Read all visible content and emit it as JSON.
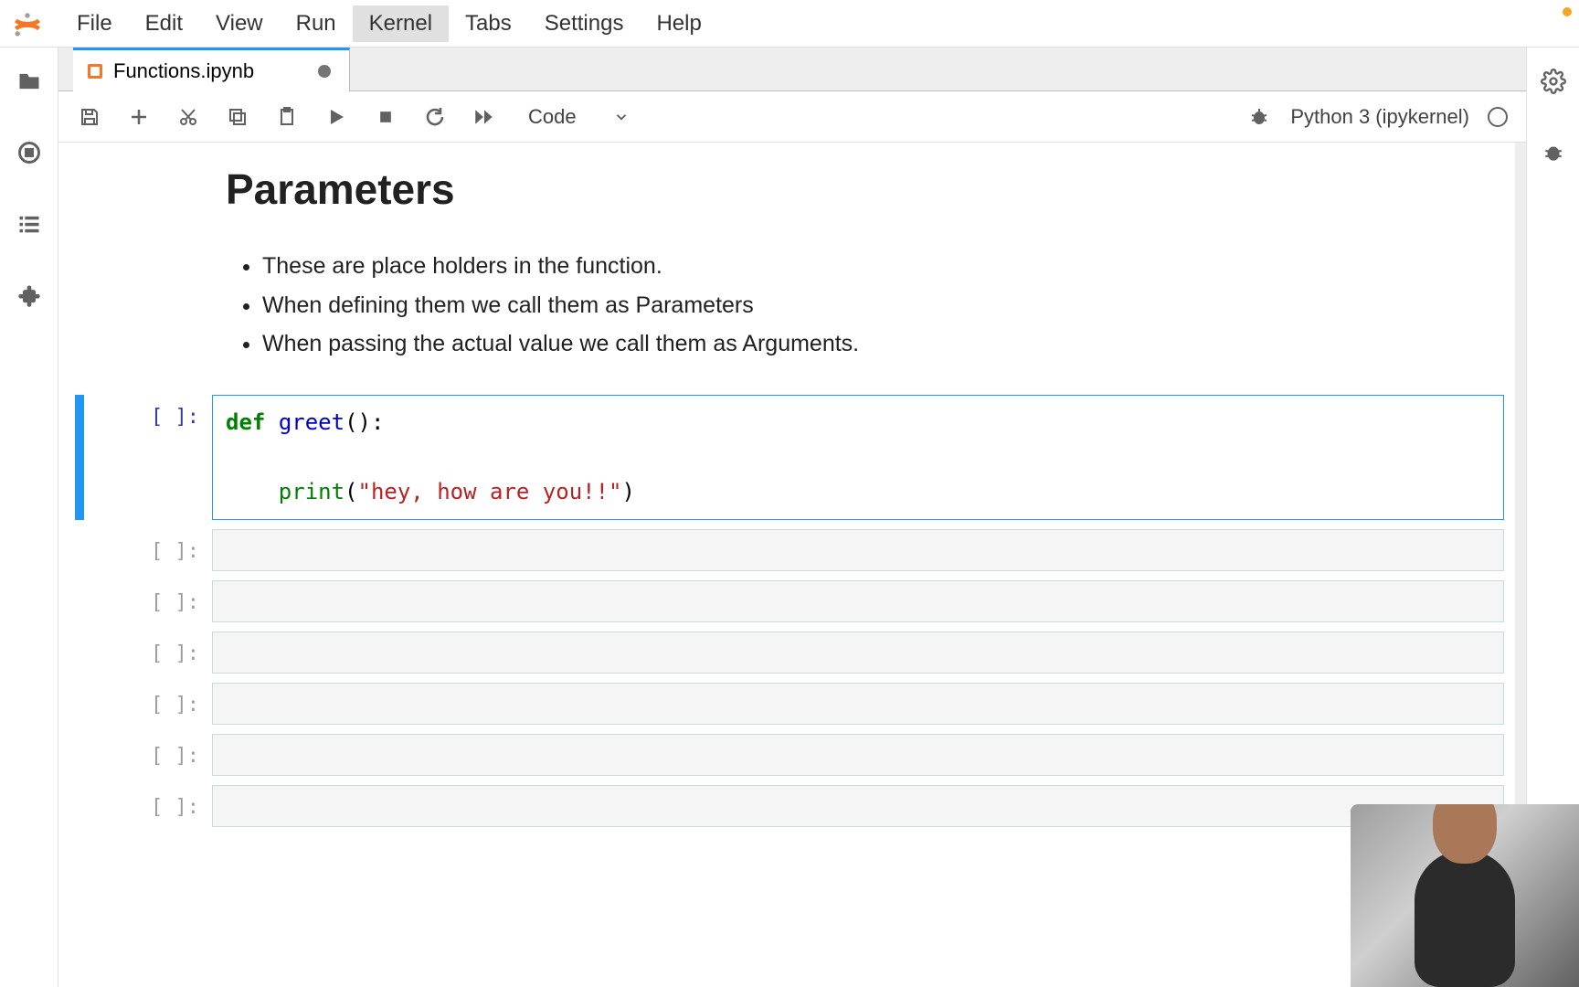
{
  "menu": {
    "items": [
      "File",
      "Edit",
      "View",
      "Run",
      "Kernel",
      "Tabs",
      "Settings",
      "Help"
    ],
    "active_index": 4
  },
  "tab": {
    "label": "Functions.ipynb"
  },
  "toolbar": {
    "cell_type": "Code",
    "kernel_name": "Python 3 (ipykernel)"
  },
  "markdown": {
    "heading": "Parameters",
    "bullets": [
      "These are place holders in the function.",
      "When defining them we call them as Parameters",
      "When passing the actual value we call them as Arguments."
    ]
  },
  "cells": {
    "prompt": "[ ]:",
    "code": {
      "kw_def": "def",
      "fn_name": "greet",
      "parens": "():",
      "builtin_print": "print",
      "lparen": "(",
      "string": "\"hey, how are you!!\"",
      "rparen": ")"
    }
  }
}
